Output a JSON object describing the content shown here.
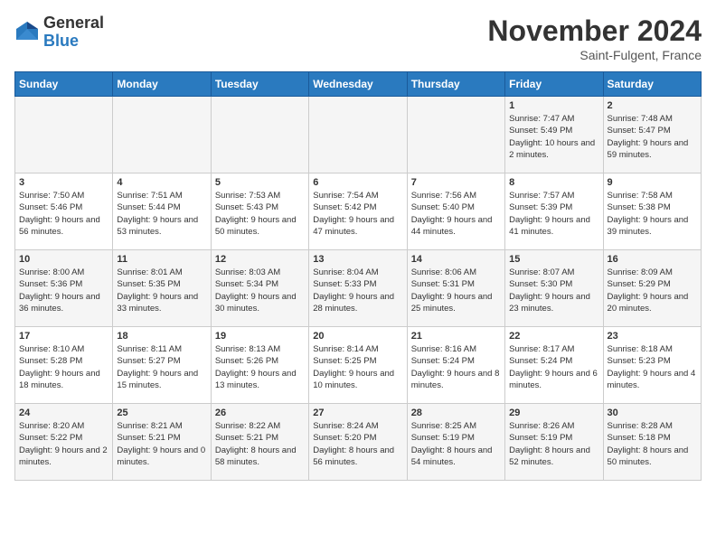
{
  "logo": {
    "general": "General",
    "blue": "Blue"
  },
  "title": "November 2024",
  "location": "Saint-Fulgent, France",
  "days_of_week": [
    "Sunday",
    "Monday",
    "Tuesday",
    "Wednesday",
    "Thursday",
    "Friday",
    "Saturday"
  ],
  "weeks": [
    [
      {
        "day": "",
        "info": ""
      },
      {
        "day": "",
        "info": ""
      },
      {
        "day": "",
        "info": ""
      },
      {
        "day": "",
        "info": ""
      },
      {
        "day": "",
        "info": ""
      },
      {
        "day": "1",
        "info": "Sunrise: 7:47 AM\nSunset: 5:49 PM\nDaylight: 10 hours and 2 minutes."
      },
      {
        "day": "2",
        "info": "Sunrise: 7:48 AM\nSunset: 5:47 PM\nDaylight: 9 hours and 59 minutes."
      }
    ],
    [
      {
        "day": "3",
        "info": "Sunrise: 7:50 AM\nSunset: 5:46 PM\nDaylight: 9 hours and 56 minutes."
      },
      {
        "day": "4",
        "info": "Sunrise: 7:51 AM\nSunset: 5:44 PM\nDaylight: 9 hours and 53 minutes."
      },
      {
        "day": "5",
        "info": "Sunrise: 7:53 AM\nSunset: 5:43 PM\nDaylight: 9 hours and 50 minutes."
      },
      {
        "day": "6",
        "info": "Sunrise: 7:54 AM\nSunset: 5:42 PM\nDaylight: 9 hours and 47 minutes."
      },
      {
        "day": "7",
        "info": "Sunrise: 7:56 AM\nSunset: 5:40 PM\nDaylight: 9 hours and 44 minutes."
      },
      {
        "day": "8",
        "info": "Sunrise: 7:57 AM\nSunset: 5:39 PM\nDaylight: 9 hours and 41 minutes."
      },
      {
        "day": "9",
        "info": "Sunrise: 7:58 AM\nSunset: 5:38 PM\nDaylight: 9 hours and 39 minutes."
      }
    ],
    [
      {
        "day": "10",
        "info": "Sunrise: 8:00 AM\nSunset: 5:36 PM\nDaylight: 9 hours and 36 minutes."
      },
      {
        "day": "11",
        "info": "Sunrise: 8:01 AM\nSunset: 5:35 PM\nDaylight: 9 hours and 33 minutes."
      },
      {
        "day": "12",
        "info": "Sunrise: 8:03 AM\nSunset: 5:34 PM\nDaylight: 9 hours and 30 minutes."
      },
      {
        "day": "13",
        "info": "Sunrise: 8:04 AM\nSunset: 5:33 PM\nDaylight: 9 hours and 28 minutes."
      },
      {
        "day": "14",
        "info": "Sunrise: 8:06 AM\nSunset: 5:31 PM\nDaylight: 9 hours and 25 minutes."
      },
      {
        "day": "15",
        "info": "Sunrise: 8:07 AM\nSunset: 5:30 PM\nDaylight: 9 hours and 23 minutes."
      },
      {
        "day": "16",
        "info": "Sunrise: 8:09 AM\nSunset: 5:29 PM\nDaylight: 9 hours and 20 minutes."
      }
    ],
    [
      {
        "day": "17",
        "info": "Sunrise: 8:10 AM\nSunset: 5:28 PM\nDaylight: 9 hours and 18 minutes."
      },
      {
        "day": "18",
        "info": "Sunrise: 8:11 AM\nSunset: 5:27 PM\nDaylight: 9 hours and 15 minutes."
      },
      {
        "day": "19",
        "info": "Sunrise: 8:13 AM\nSunset: 5:26 PM\nDaylight: 9 hours and 13 minutes."
      },
      {
        "day": "20",
        "info": "Sunrise: 8:14 AM\nSunset: 5:25 PM\nDaylight: 9 hours and 10 minutes."
      },
      {
        "day": "21",
        "info": "Sunrise: 8:16 AM\nSunset: 5:24 PM\nDaylight: 9 hours and 8 minutes."
      },
      {
        "day": "22",
        "info": "Sunrise: 8:17 AM\nSunset: 5:24 PM\nDaylight: 9 hours and 6 minutes."
      },
      {
        "day": "23",
        "info": "Sunrise: 8:18 AM\nSunset: 5:23 PM\nDaylight: 9 hours and 4 minutes."
      }
    ],
    [
      {
        "day": "24",
        "info": "Sunrise: 8:20 AM\nSunset: 5:22 PM\nDaylight: 9 hours and 2 minutes."
      },
      {
        "day": "25",
        "info": "Sunrise: 8:21 AM\nSunset: 5:21 PM\nDaylight: 9 hours and 0 minutes."
      },
      {
        "day": "26",
        "info": "Sunrise: 8:22 AM\nSunset: 5:21 PM\nDaylight: 8 hours and 58 minutes."
      },
      {
        "day": "27",
        "info": "Sunrise: 8:24 AM\nSunset: 5:20 PM\nDaylight: 8 hours and 56 minutes."
      },
      {
        "day": "28",
        "info": "Sunrise: 8:25 AM\nSunset: 5:19 PM\nDaylight: 8 hours and 54 minutes."
      },
      {
        "day": "29",
        "info": "Sunrise: 8:26 AM\nSunset: 5:19 PM\nDaylight: 8 hours and 52 minutes."
      },
      {
        "day": "30",
        "info": "Sunrise: 8:28 AM\nSunset: 5:18 PM\nDaylight: 8 hours and 50 minutes."
      }
    ]
  ]
}
